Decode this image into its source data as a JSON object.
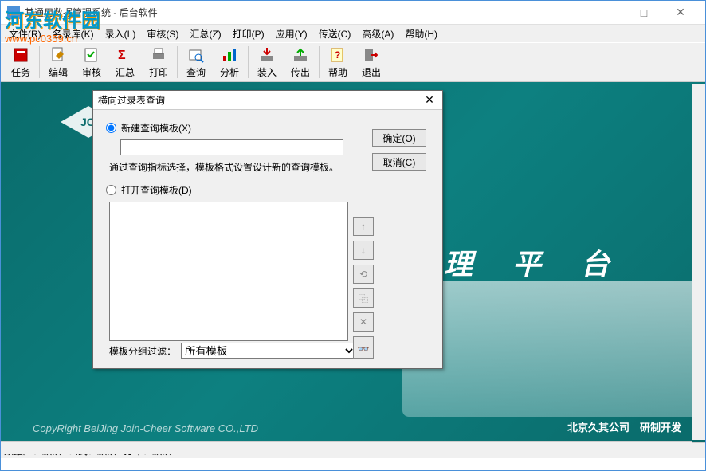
{
  "window": {
    "title": "其通用数据管理系统 - 后台软件"
  },
  "watermark": {
    "line1": "河东软件园",
    "line2": "www.pc0359.cn"
  },
  "titlebar_controls": {
    "min": "—",
    "max": "□",
    "close": "✕"
  },
  "menu": {
    "items": [
      "文件(R)",
      "名录库(K)",
      "录入(L)",
      "审核(S)",
      "汇总(Z)",
      "打印(P)",
      "应用(Y)",
      "传送(C)",
      "高级(A)",
      "帮助(H)"
    ]
  },
  "toolbar": {
    "items": [
      "任务",
      "编辑",
      "审核",
      "汇总",
      "打印",
      "查询",
      "分析",
      "装入",
      "传出",
      "帮助",
      "退出"
    ]
  },
  "dialog": {
    "title": "横向过录表查询",
    "close": "✕",
    "radio_new": "新建查询模板(X)",
    "hint": "通过查询指标选择，模板格式设置设计新的查询模板。",
    "radio_open": "打开查询模板(D)",
    "ok": "确定(O)",
    "cancel": "取消(C)",
    "filter_label": "模板分组过滤：",
    "filter_value": "所有模板",
    "side_icons": [
      "↑",
      "↓",
      "⟲",
      "⿻",
      "✕",
      "⿴"
    ],
    "search_icon": "🔍"
  },
  "content": {
    "platform": "理 平 台",
    "copyright": "CopyRight BeiJing Join-Cheer Software CO.,LTD",
    "company": "北京久其公司　研制开发"
  },
  "statusbar": {
    "db_label": "数据库：",
    "db_val": "默认",
    "formula_label": "公式：",
    "formula_val": "默认",
    "print_label": "打印：",
    "print_val": "默认"
  }
}
